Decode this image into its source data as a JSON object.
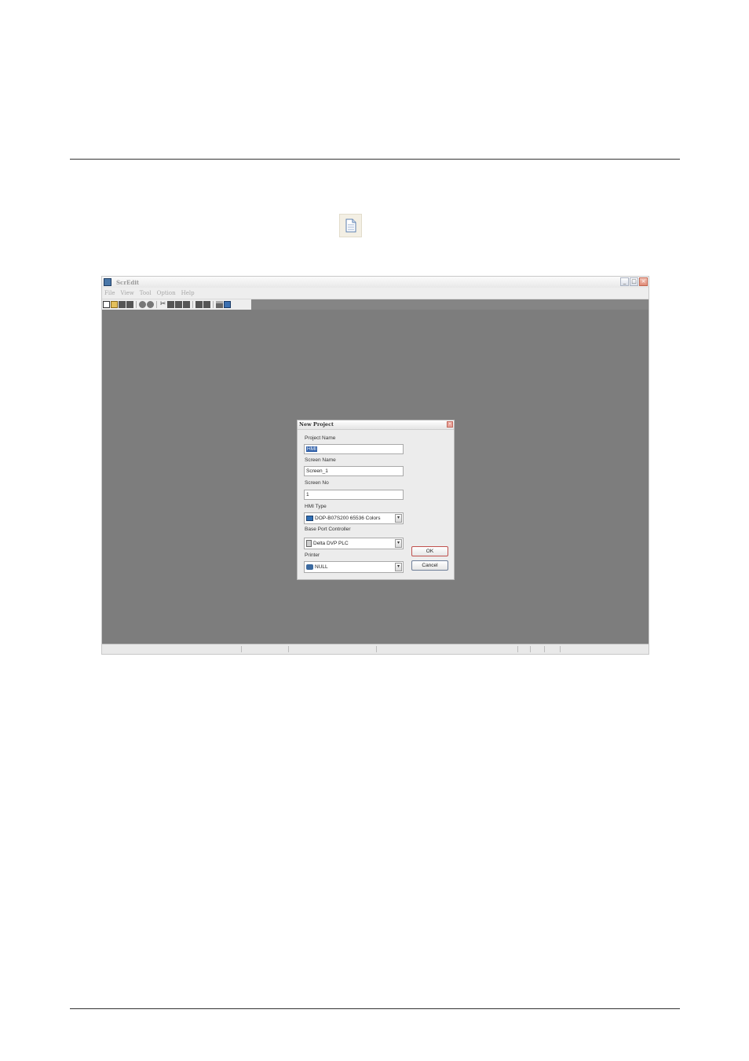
{
  "app": {
    "title": "ScrEdit",
    "menu": [
      "File",
      "View",
      "Tool",
      "Option",
      "Help"
    ],
    "window_buttons": {
      "minimize": "_",
      "maximize": "□",
      "close": "×"
    }
  },
  "dialog": {
    "title": "New Project",
    "close": "×",
    "project_name_label": "Project Name",
    "project_name_value": "HMI",
    "screen_name_label": "Screen Name",
    "screen_name_value": "Screen_1",
    "screen_no_label": "Screen No",
    "screen_no_value": "1",
    "hmi_type_label": "HMI Type",
    "hmi_type_value": "DOP-B07S200 65536 Colors",
    "base_port_label": "Base Port Controller",
    "base_port_value": "Delta DVP PLC",
    "printer_label": "Printer",
    "printer_value": "NULL",
    "ok_label": "OK",
    "cancel_label": "Cancel",
    "dropdown_arrow": "▾"
  }
}
